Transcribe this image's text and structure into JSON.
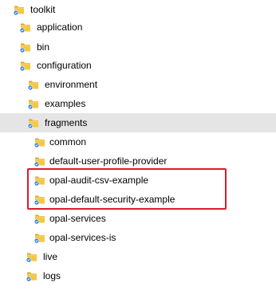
{
  "colors": {
    "folder_front": "#f5c842",
    "folder_back": "#dba82e",
    "badge_blue": "#2f7fd8",
    "selection": "#e5e5e5",
    "highlight_border": "#e0182d"
  },
  "tree": {
    "items": [
      {
        "label": "toolkit",
        "icon": "folder-icon",
        "depth": 0
      },
      {
        "label": "application",
        "icon": "folder-icon",
        "depth": 1
      },
      {
        "label": "bin",
        "icon": "folder-icon",
        "depth": 1
      },
      {
        "label": "configuration",
        "icon": "folder-icon",
        "depth": 1
      },
      {
        "label": "environment",
        "icon": "folder-icon",
        "depth": 2
      },
      {
        "label": "examples",
        "icon": "folder-icon",
        "depth": 2
      },
      {
        "label": "fragments",
        "icon": "folder-icon",
        "depth": 2,
        "selected": true
      },
      {
        "label": "common",
        "icon": "folder-icon",
        "depth": 3
      },
      {
        "label": "default-user-profile-provider",
        "icon": "folder-icon",
        "depth": 3
      },
      {
        "label": "opal-audit-csv-example",
        "icon": "folder-icon",
        "depth": 3,
        "highlighted": true
      },
      {
        "label": "opal-default-security-example",
        "icon": "folder-icon",
        "depth": 3,
        "highlighted": true
      },
      {
        "label": "opal-services",
        "icon": "folder-icon",
        "depth": 3
      },
      {
        "label": "opal-services-is",
        "icon": "folder-icon",
        "depth": 3
      },
      {
        "label": "live",
        "icon": "folder-icon",
        "depth": 1
      },
      {
        "label": "logs",
        "icon": "folder-icon",
        "depth": 1
      }
    ]
  }
}
